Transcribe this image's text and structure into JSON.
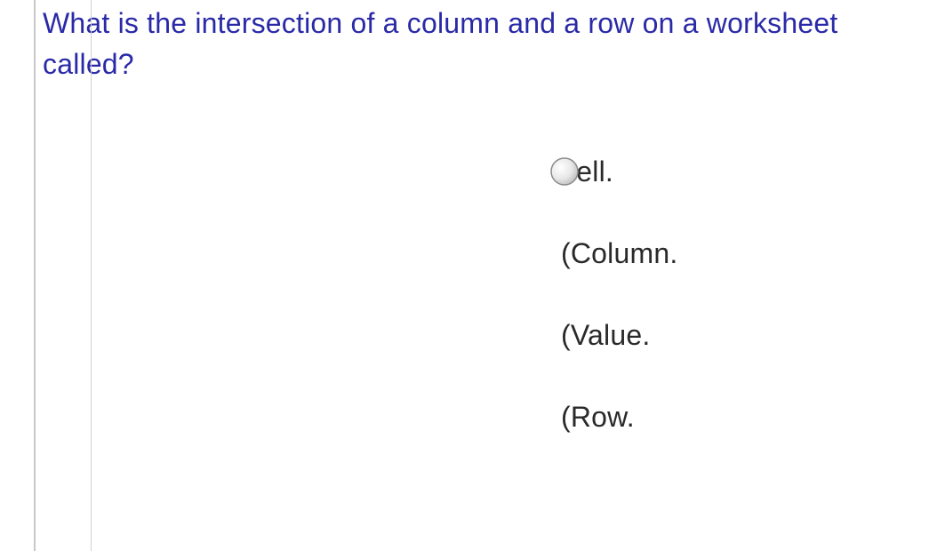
{
  "question": "What is the intersection of a column and a row on a worksheet called?",
  "options": [
    {
      "label": "Cell.",
      "selected": true
    },
    {
      "label": "Column.",
      "selected": false
    },
    {
      "label": "Value.",
      "selected": false
    },
    {
      "label": "Row.",
      "selected": false
    }
  ]
}
